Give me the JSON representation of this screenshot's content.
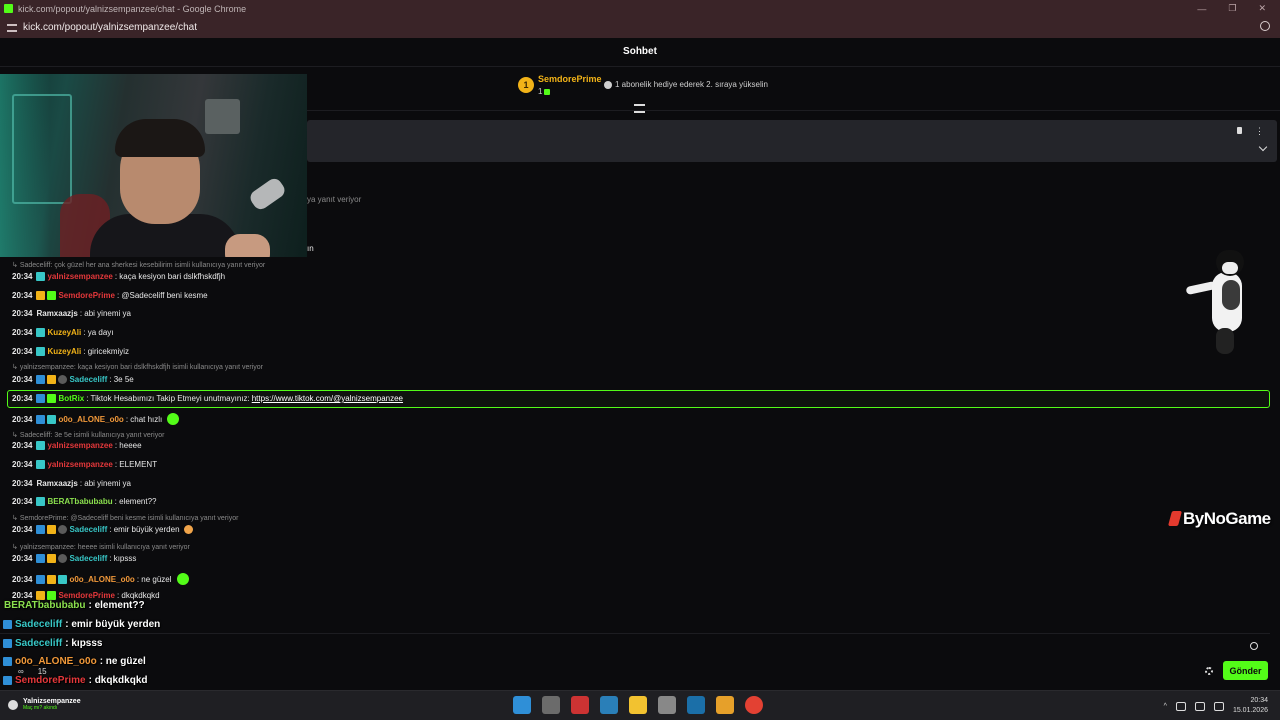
{
  "window": {
    "title": "kick.com/popout/yalnizsempanzee/chat - Google Chrome",
    "controls": [
      "—",
      "❐",
      "✕"
    ]
  },
  "address_bar": {
    "url": "kick.com/popout/yalnizsempanzee/chat"
  },
  "chat": {
    "header_title": "Sohbet",
    "leaderboard": {
      "rank": "1",
      "name": "SemdorePrime",
      "count": "1",
      "gift_hint": "1 abonelik hediye ederek 2. sıraya yükselin"
    },
    "behind_text_1": "ya yanıt veriyor",
    "behind_text_2": "ın",
    "messages": [
      {
        "reply": "Sadeceliff: çok güzel her ana sherkesi kesebilirim isimli kullanıcıya yanıt veriyor"
      },
      {
        "time": "20:34",
        "badges": [
          "bt"
        ],
        "user": "yalnizsempanzee",
        "color": "#e5383b",
        "text": ": kaça kesiyon bari dslkfhskdfjh"
      },
      {
        "time": "20:34",
        "badges": [
          "bc",
          "bg"
        ],
        "user": "SemdorePrime",
        "color": "#e5383b",
        "text": ": @Sadeceliff beni kesme"
      },
      {
        "time": "20:34",
        "badges": [],
        "user": "Ramxaazjs",
        "color": "#e8e8e8",
        "text": ": abi yinemi ya"
      },
      {
        "time": "20:34",
        "badges": [
          "bt"
        ],
        "user": "KuzeyAli",
        "color": "#f2b318",
        "text": ": ya dayı"
      },
      {
        "time": "20:34",
        "badges": [
          "bt"
        ],
        "user": "KuzeyAli",
        "color": "#f2b318",
        "text": ": giricekmiyiz"
      },
      {
        "reply": "yalnizsempanzee: kaça kesiyon bari dslkfhskdfjh isimli kullanıcıya yanıt veriyor"
      },
      {
        "time": "20:34",
        "badges": [
          "bb",
          "bc",
          "bv"
        ],
        "user": "Sadeceliff",
        "color": "#38c7c7",
        "text": ": 3e 5e"
      },
      {
        "time": "20:34",
        "badges": [
          "bb",
          "bg"
        ],
        "user": "BotRix",
        "color": "#53fc18",
        "text": ": Tiktok Hesabımızı Takip Etmeyi unutmayınız: ",
        "link": "https://www.tiktok.com/@yalnizsempanzee",
        "highlight": true
      },
      {
        "time": "20:34",
        "badges": [
          "bb",
          "bt"
        ],
        "user": "o0o_ALONE_o0o",
        "color": "#f2993a",
        "text": ": chat hızlı",
        "emote": true
      },
      {
        "reply": "Sadeceliff: 3e 5e isimli kullanıcıya yanıt veriyor"
      },
      {
        "time": "20:34",
        "badges": [
          "bt"
        ],
        "user": "yalnizsempanzee",
        "color": "#e5383b",
        "text": ": heeee"
      },
      {
        "time": "20:34",
        "badges": [
          "bt"
        ],
        "user": "yalnizsempanzee",
        "color": "#e5383b",
        "text": ": ELEMENT"
      },
      {
        "time": "20:34",
        "badges": [],
        "user": "Ramxaazjs",
        "color": "#e8e8e8",
        "text": ": abi yinemi ya"
      },
      {
        "time": "20:34",
        "badges": [
          "bt"
        ],
        "user": "BERATbabubabu",
        "color": "#8be04e",
        "text": ": element??"
      },
      {
        "reply": "SemdorePrime: @Sadeceliff beni kesme isimli kullanıcıya yanıt veriyor"
      },
      {
        "time": "20:34",
        "badges": [
          "bb",
          "bc",
          "bv"
        ],
        "user": "Sadeceliff",
        "color": "#38c7c7",
        "text": ": emir büyük yerden",
        "emote2": true
      },
      {
        "reply": "yalnizsempanzee: heeee isimli kullanıcıya yanıt veriyor"
      },
      {
        "time": "20:34",
        "badges": [
          "bb",
          "bc",
          "bv"
        ],
        "user": "Sadeceliff",
        "color": "#38c7c7",
        "text": ": kıpsss"
      },
      {
        "time": "20:34",
        "badges": [
          "bb",
          "bc",
          "bt"
        ],
        "user": "o0o_ALONE_o0o",
        "color": "#f2993a",
        "text": ": ne güzel",
        "emote": true
      },
      {
        "time": "20:34",
        "badges": [
          "bc",
          "bg"
        ],
        "user": "SemdorePrime",
        "color": "#e5383b",
        "text": ": dkqkdkqkd"
      }
    ],
    "overlay": [
      {
        "user": "BERATbabubabu",
        "color": "#8be04e",
        "text": ": element??"
      },
      {
        "user": "Sadeceliff",
        "color": "#38c7c7",
        "text": ": emir büyük yerden"
      },
      {
        "user": "Sadeceliff",
        "color": "#38c7c7",
        "text": ": kıpsss"
      },
      {
        "user": "o0o_ALONE_o0o",
        "color": "#f2993a",
        "text": ": ne güzel"
      },
      {
        "user": "SemdorePrime",
        "color": "#e5383b",
        "text": ": dkqkdkqkd"
      }
    ],
    "stats": {
      "viewers": "∞",
      "count": "15"
    },
    "send_label": "Gönder"
  },
  "brand": "ByNoGame",
  "taskbar": {
    "user_name": "Yalnizsempanzee",
    "user_status": "Maç mı? akındı",
    "app_icons": [
      "start-icon",
      "task-view-icon",
      "app-icon",
      "photos-icon",
      "file-explorer-icon",
      "app-icon-2",
      "steam-icon",
      "app-icon-3",
      "chrome-icon"
    ],
    "time": "20:34",
    "date": "15.01.2026"
  },
  "colors": {
    "accent": "#53fc18",
    "titlebar": "#3a2428",
    "bg": "#0b0b0d"
  }
}
